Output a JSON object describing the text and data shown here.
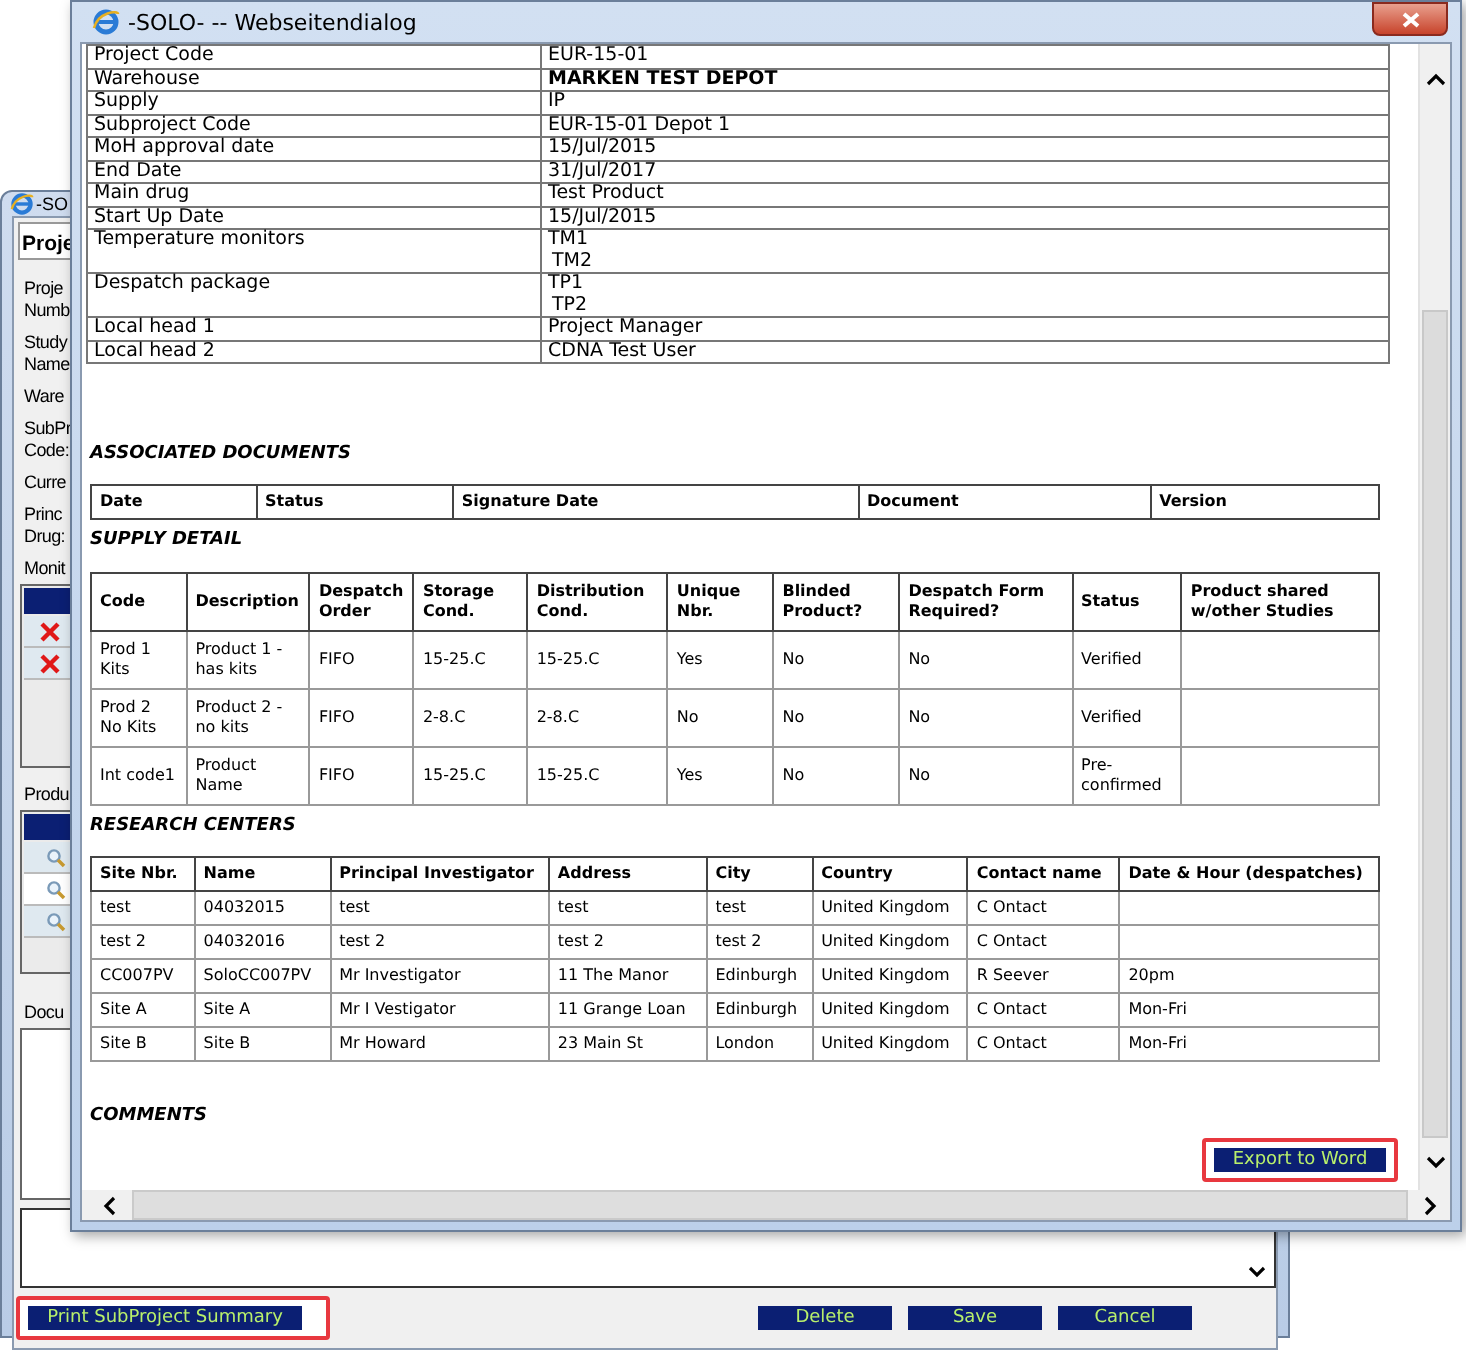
{
  "background_window": {
    "title": "-SO",
    "heading": "Proje",
    "labels": [
      [
        "Proje",
        "Numb"
      ],
      [
        "Study",
        "Name"
      ],
      [
        "Ware"
      ],
      [
        "SubPr",
        "Code:"
      ],
      [
        "Curre"
      ],
      [
        "Princ",
        "Drug:"
      ]
    ],
    "monitors_label": "Monit",
    "products_label": "Produ",
    "documents_label": "Docu",
    "print_button": {
      "label": "Print SubProject Summary",
      "highlighted": true
    },
    "buttons": [
      "Delete",
      "Save",
      "Cancel"
    ]
  },
  "dialog": {
    "title": "-SOLO- -- Webseitendialog",
    "details": [
      {
        "label": "Project Code",
        "values": [
          "EUR-15-01"
        ],
        "bold": false
      },
      {
        "label": "Warehouse",
        "values": [
          "MARKEN TEST DEPOT"
        ],
        "bold": true
      },
      {
        "label": "Supply",
        "values": [
          "IP"
        ],
        "bold": false
      },
      {
        "label": "Subproject Code",
        "values": [
          "EUR-15-01 Depot 1"
        ],
        "bold": false
      },
      {
        "label": "MoH approval date",
        "values": [
          "15/Jul/2015"
        ],
        "bold": false
      },
      {
        "label": "End Date",
        "values": [
          "31/Jul/2017"
        ],
        "bold": false
      },
      {
        "label": "Main drug",
        "values": [
          "Test Product"
        ],
        "bold": false
      },
      {
        "label": "Start Up Date",
        "values": [
          "15/Jul/2015"
        ],
        "bold": false
      },
      {
        "label": "Temperature monitors",
        "values": [
          "TM1",
          "TM2"
        ],
        "bold": false
      },
      {
        "label": "Despatch package",
        "values": [
          "TP1",
          "TP2"
        ],
        "bold": false
      },
      {
        "label": "Local head 1",
        "values": [
          "Project Manager"
        ],
        "bold": false
      },
      {
        "label": "Local head 2",
        "values": [
          "CDNA Test User"
        ],
        "bold": false
      }
    ],
    "associated_documents": {
      "title": "ASSOCIATED DOCUMENTS",
      "columns": [
        "Date",
        "Status",
        "Signature Date",
        "Document",
        "Version"
      ]
    },
    "supply_detail": {
      "title": "SUPPLY DETAIL",
      "columns": [
        "Code",
        "Description",
        "Despatch Order",
        "Storage Cond.",
        "Distribution Cond.",
        "Unique Nbr.",
        "Blinded Product?",
        "Despatch Form Required?",
        "Status",
        "Product shared w/other Studies"
      ],
      "rows": [
        [
          "Prod 1 Kits",
          "Product 1 - has kits",
          "FIFO",
          "15-25.C",
          "15-25.C",
          "Yes",
          "No",
          "No",
          "Verified",
          null
        ],
        [
          "Prod 2 No Kits",
          "Product 2 - no kits",
          "FIFO",
          "2-8.C",
          "2-8.C",
          "No",
          "No",
          "No",
          "Verified",
          null
        ],
        [
          "Int code1",
          "Product Name",
          "FIFO",
          "15-25.C",
          "15-25.C",
          "Yes",
          "No",
          "No",
          "Pre-confirmed",
          null
        ]
      ]
    },
    "research_centers": {
      "title": "RESEARCH CENTERS",
      "columns": [
        "Site Nbr.",
        "Name",
        "Principal Investigator",
        "Address",
        "City",
        "Country",
        "Contact name",
        "Date & Hour (despatches)"
      ],
      "rows": [
        [
          "test",
          "04032015",
          "test",
          "test",
          "test",
          "United Kingdom",
          "C Ontact",
          null
        ],
        [
          "test 2",
          "04032016",
          "test 2",
          "test 2",
          "test 2",
          "United Kingdom",
          "C Ontact",
          null
        ],
        [
          "CC007PV",
          "SoloCC007PV",
          "Mr Investigator",
          "11 The Manor",
          "Edinburgh",
          "United Kingdom",
          "R Seever",
          "20pm"
        ],
        [
          "Site A",
          "Site A",
          "Mr I Vestigator",
          "11 Grange Loan",
          "Edinburgh",
          "United Kingdom",
          "C Ontact",
          "Mon-Fri"
        ],
        [
          "Site B",
          "Site B",
          "Mr Howard",
          "23 Main St",
          "London",
          "United Kingdom",
          "C Ontact",
          "Mon-Fri"
        ]
      ]
    },
    "comments": {
      "title": "COMMENTS"
    },
    "export_button": {
      "label": "Export to Word",
      "highlighted": true
    }
  }
}
